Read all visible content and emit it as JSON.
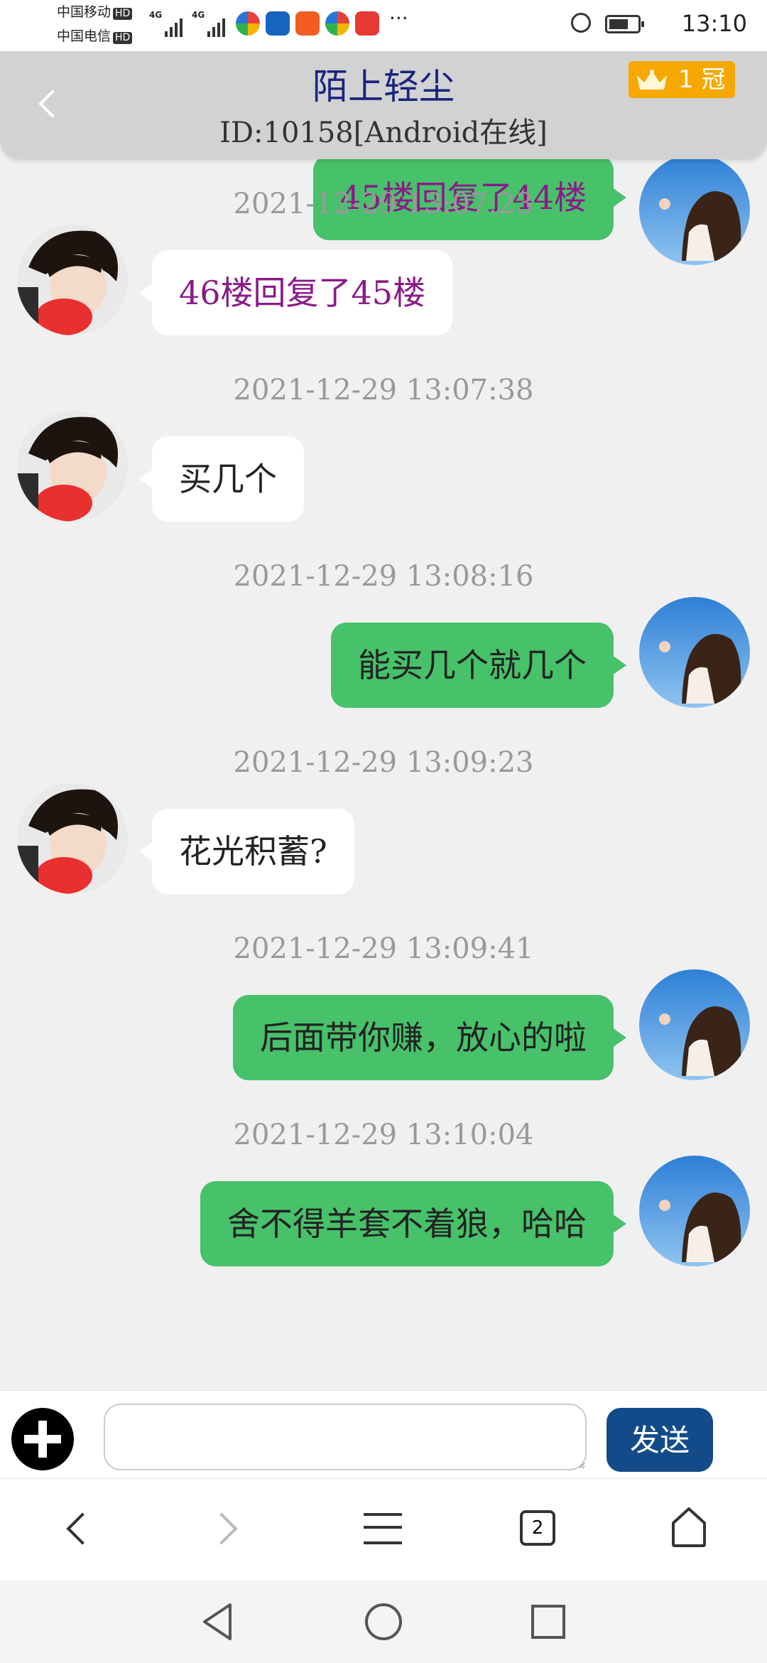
{
  "status_bar": {
    "carrier_1": "中国移动",
    "carrier_2": "中国电信",
    "hd_label": "HD",
    "signal_label_1": "4G",
    "signal_label_2": "4G",
    "more": "···",
    "time": "13:10"
  },
  "header": {
    "title": "陌上轻尘",
    "subtitle": "ID:10158[Android在线]",
    "badge_count": "1",
    "badge_label": "冠",
    "badge_color": "#f7a800"
  },
  "messages": [
    {
      "side": "right",
      "timestamp": "",
      "text": "45楼回复了44楼",
      "text_color": "#8b1a89"
    },
    {
      "side": "left",
      "timestamp": "2021-12-29  13:07:23",
      "text": "46楼回复了45楼",
      "text_color": "#8b1a89"
    },
    {
      "side": "left",
      "timestamp": "2021-12-29  13:07:38",
      "text": "买几个",
      "text_color": "#222222"
    },
    {
      "side": "right",
      "timestamp": "2021-12-29  13:08:16",
      "text": "能买几个就几个",
      "text_color": "#222222"
    },
    {
      "side": "left",
      "timestamp": "2021-12-29  13:09:23",
      "text": "花光积蓄?",
      "text_color": "#222222"
    },
    {
      "side": "right",
      "timestamp": "2021-12-29  13:09:41",
      "text": "后面带你赚，放心的啦",
      "text_color": "#222222"
    },
    {
      "side": "right",
      "timestamp": "2021-12-29  13:10:04",
      "text": "舍不得羊套不着狼，哈哈",
      "text_color": "#222222"
    }
  ],
  "input_bar": {
    "value": "",
    "send_label": "发送"
  },
  "browser_bar": {
    "tab_count": "2"
  },
  "colors": {
    "outgoing_bubble": "#47c16a",
    "incoming_bubble": "#ffffff",
    "send_button": "#134b8a",
    "header_bg": "#d2d2d2"
  }
}
